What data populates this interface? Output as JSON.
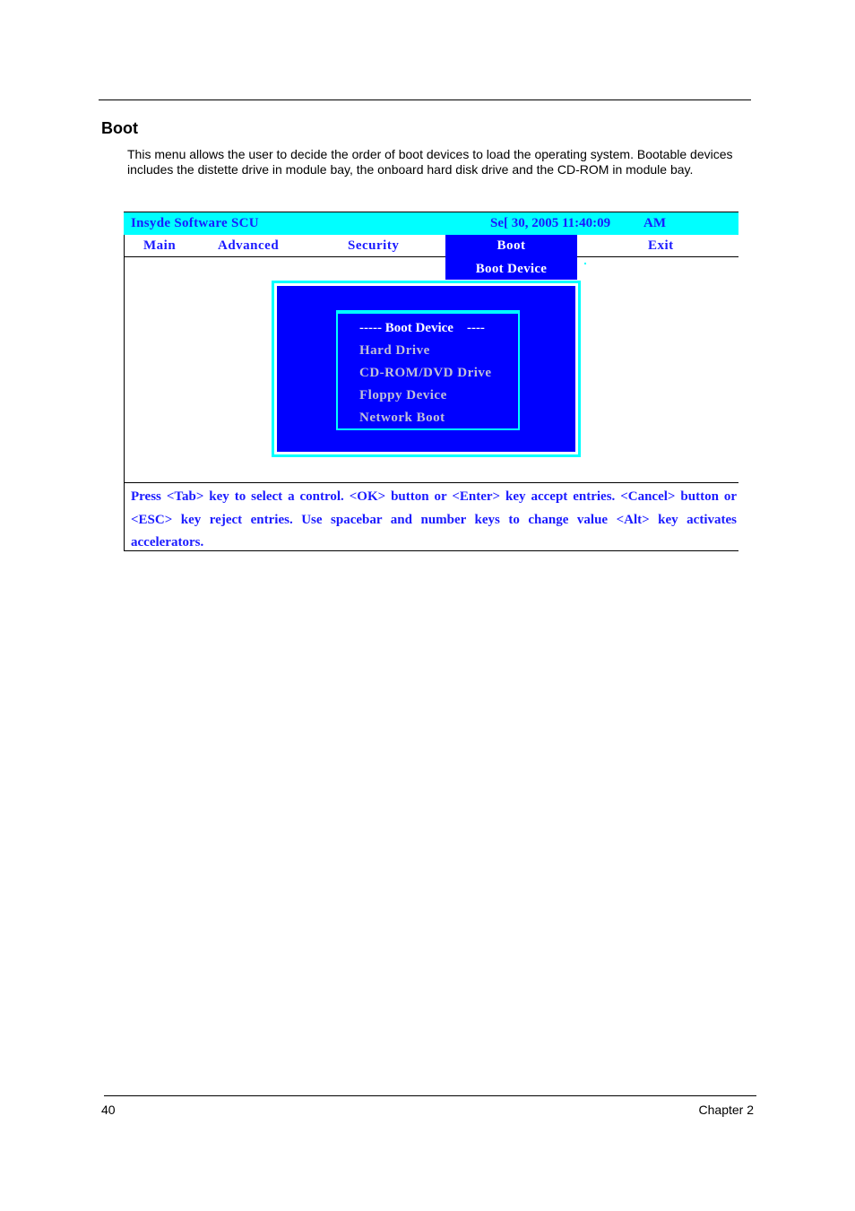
{
  "document": {
    "section_title": "Boot",
    "intro": "This menu allows the user to decide the order of boot devices to load the operating system. Bootable devices includes the distette drive in module bay, the onboard hard disk drive and the CD-ROM in module bay."
  },
  "bios": {
    "title": "Insyde Software SCU",
    "date": "Se[ 30, 2005 11:40:09",
    "ampm": "AM",
    "menu": [
      {
        "label": "Main",
        "active": false
      },
      {
        "label": "Advanced",
        "active": false
      },
      {
        "label": "Security",
        "active": false
      },
      {
        "label": "Boot",
        "active": true
      },
      {
        "label": "Exit",
        "active": false
      }
    ],
    "submenu_label": "Boot Device",
    "dialog": {
      "header": "----- Boot Device    ----",
      "options": [
        "Hard Drive",
        "CD-ROM/DVD Drive",
        "Floppy Device",
        "Network Boot"
      ]
    },
    "help_text": "Press <Tab> key to select a control. <OK> button or <Enter> key accept entries. <Cancel> button or <ESC> key reject entries. Use spacebar and number keys to change value <Alt> key activates accelerators.",
    "colors": {
      "title_bar": "#00ffff",
      "text_blue": "#1a1aff",
      "active_bg": "#0000ff",
      "border_cyan": "#00ffff"
    }
  },
  "footer": {
    "page_number": "40",
    "chapter": "Chapter 2"
  }
}
